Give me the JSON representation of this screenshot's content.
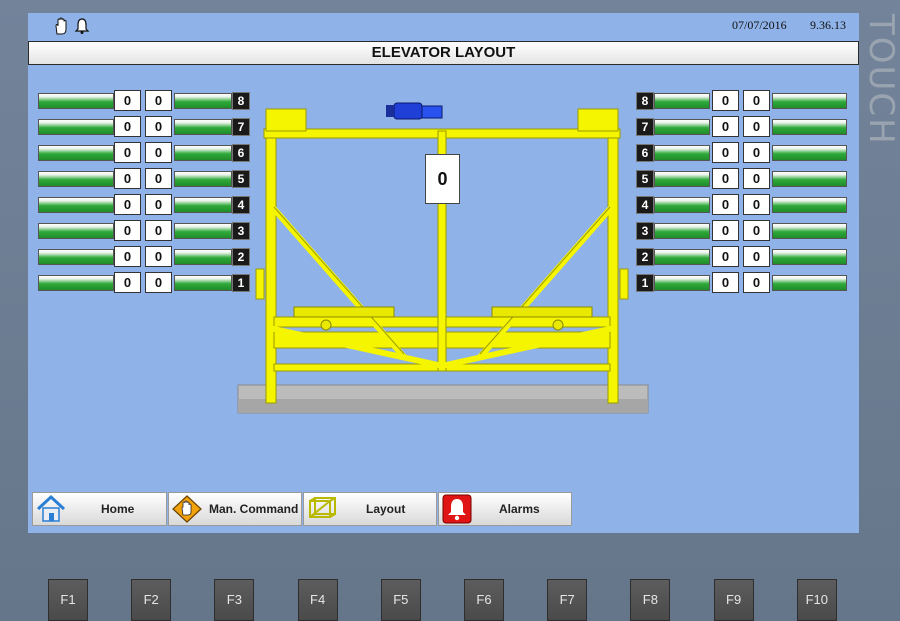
{
  "status": {
    "date": "07/07/2016",
    "time": "9.36.13",
    "icons": [
      "hand-icon",
      "bell-icon"
    ]
  },
  "bezel": {
    "label": "TOUCH"
  },
  "title": "ELEVATOR LAYOUT",
  "left_floors": [
    {
      "floor": "8",
      "value_a": "0",
      "value_b": "0"
    },
    {
      "floor": "7",
      "value_a": "0",
      "value_b": "0"
    },
    {
      "floor": "6",
      "value_a": "0",
      "value_b": "0"
    },
    {
      "floor": "5",
      "value_a": "0",
      "value_b": "0"
    },
    {
      "floor": "4",
      "value_a": "0",
      "value_b": "0"
    },
    {
      "floor": "3",
      "value_a": "0",
      "value_b": "0"
    },
    {
      "floor": "2",
      "value_a": "0",
      "value_b": "0"
    },
    {
      "floor": "1",
      "value_a": "0",
      "value_b": "0"
    }
  ],
  "right_floors": [
    {
      "floor": "8",
      "value_a": "0",
      "value_b": "0"
    },
    {
      "floor": "7",
      "value_a": "0",
      "value_b": "0"
    },
    {
      "floor": "6",
      "value_a": "0",
      "value_b": "0"
    },
    {
      "floor": "5",
      "value_a": "0",
      "value_b": "0"
    },
    {
      "floor": "4",
      "value_a": "0",
      "value_b": "0"
    },
    {
      "floor": "3",
      "value_a": "0",
      "value_b": "0"
    },
    {
      "floor": "2",
      "value_a": "0",
      "value_b": "0"
    },
    {
      "floor": "1",
      "value_a": "0",
      "value_b": "0"
    }
  ],
  "elevator": {
    "load_value": "0"
  },
  "nav": [
    {
      "label": "Home",
      "icon": "home-icon"
    },
    {
      "label": "Man. Command",
      "icon": "hand-warning-icon"
    },
    {
      "label": "Layout",
      "icon": "layout-icon"
    },
    {
      "label": "Alarms",
      "icon": "alarm-bell-icon"
    }
  ],
  "function_keys": [
    "F1",
    "F2",
    "F3",
    "F4",
    "F5",
    "F6",
    "F7",
    "F8",
    "F9",
    "F10"
  ],
  "colors": {
    "screen": "#8fb3e8",
    "frame": "#f5f500",
    "bar": "#2faa3a",
    "motor": "#1f3fd6"
  }
}
